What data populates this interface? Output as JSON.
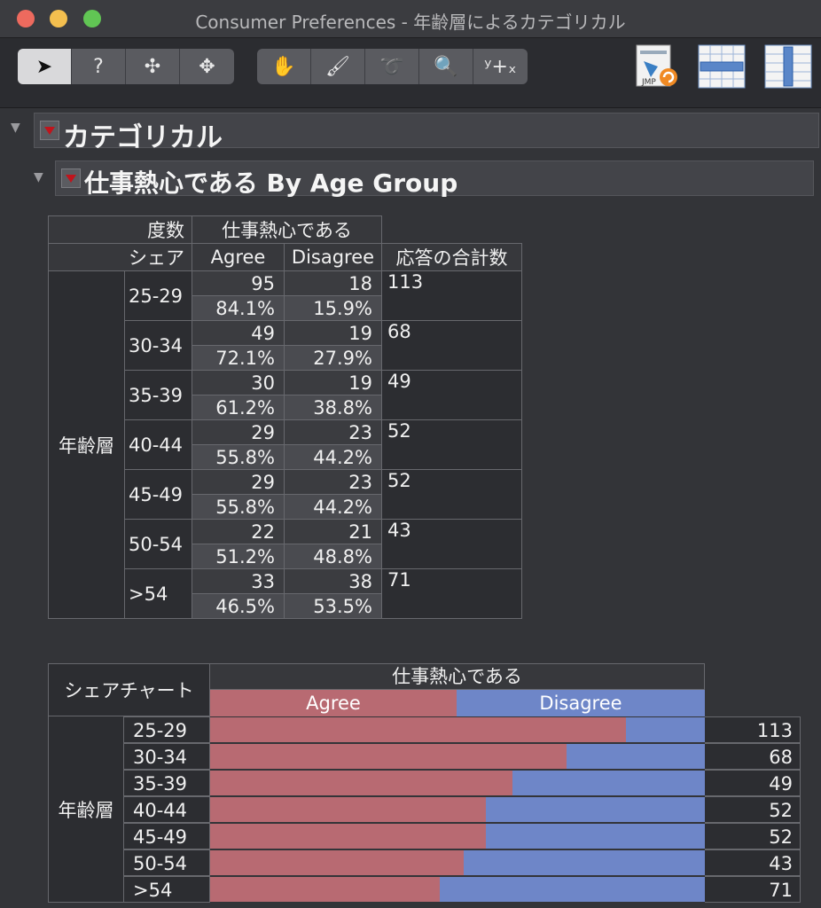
{
  "window": {
    "title": "Consumer Preferences - 年齢層によるカテゴリカル"
  },
  "toolbar": {
    "group1": [
      {
        "icon": "arrow-pointer-icon",
        "glyph": "➤"
      },
      {
        "icon": "help-question-icon",
        "glyph": "?"
      },
      {
        "icon": "crosshair-select-icon",
        "glyph": "✣"
      },
      {
        "icon": "move-arrows-icon",
        "glyph": "✥"
      }
    ],
    "group2": [
      {
        "icon": "grabber-hand-icon",
        "glyph": "✋"
      },
      {
        "icon": "brush-icon",
        "glyph": "🖌"
      },
      {
        "icon": "lasso-icon",
        "glyph": "➰"
      },
      {
        "icon": "magnifier-icon",
        "glyph": "🔍"
      },
      {
        "icon": "xy-annotate-icon",
        "glyph": "ʸ+ₓ"
      }
    ],
    "right_icons": [
      "jmp-script-icon",
      "row-layout-icon",
      "column-layout-icon"
    ],
    "jmp_label": "JMP"
  },
  "report": {
    "outline_title": "カテゴリカル",
    "sub_title": "仕事熱心である By Age Group"
  },
  "crosstab": {
    "corner_line1": "度数",
    "corner_line2": "シェア",
    "response_header": "仕事熱心である",
    "columns": [
      "Agree",
      "Disagree"
    ],
    "total_header": "応答の合計数",
    "row_group": "年齢層",
    "rows": [
      {
        "age": "25-29",
        "agree": "95",
        "agree_pct": "84.1%",
        "disagree": "18",
        "disagree_pct": "15.9%",
        "total": "113"
      },
      {
        "age": "30-34",
        "agree": "49",
        "agree_pct": "72.1%",
        "disagree": "19",
        "disagree_pct": "27.9%",
        "total": "68"
      },
      {
        "age": "35-39",
        "agree": "30",
        "agree_pct": "61.2%",
        "disagree": "19",
        "disagree_pct": "38.8%",
        "total": "49"
      },
      {
        "age": "40-44",
        "agree": "29",
        "agree_pct": "55.8%",
        "disagree": "23",
        "disagree_pct": "44.2%",
        "total": "52"
      },
      {
        "age": "45-49",
        "agree": "29",
        "agree_pct": "55.8%",
        "disagree": "23",
        "disagree_pct": "44.2%",
        "total": "52"
      },
      {
        "age": "50-54",
        "agree": "22",
        "agree_pct": "51.2%",
        "disagree": "21",
        "disagree_pct": "48.8%",
        "total": "43"
      },
      {
        "age": ">54",
        "agree": "33",
        "agree_pct": "46.5%",
        "disagree": "38",
        "disagree_pct": "53.5%",
        "total": "71"
      }
    ]
  },
  "share_chart": {
    "corner_label": "シェアチャート",
    "response_header": "仕事熱心である",
    "legend": [
      "Agree",
      "Disagree"
    ],
    "row_group": "年齢層",
    "colors": {
      "agree": "#b86a72",
      "disagree": "#6e86c8"
    }
  },
  "chart_data": {
    "type": "bar",
    "categories": [
      "25-29",
      "30-34",
      "35-39",
      "40-44",
      "45-49",
      "50-54",
      ">54"
    ],
    "series": [
      {
        "name": "Agree",
        "values": [
          84.1,
          72.1,
          61.2,
          55.8,
          55.8,
          51.2,
          46.5
        ]
      },
      {
        "name": "Disagree",
        "values": [
          15.9,
          27.9,
          38.8,
          44.2,
          44.2,
          48.8,
          53.5
        ]
      }
    ],
    "totals": [
      "113",
      "68",
      "49",
      "52",
      "52",
      "43",
      "71"
    ],
    "stacked": true,
    "orientation": "horizontal",
    "xlim": [
      0,
      100
    ],
    "title": "シェアチャート"
  }
}
